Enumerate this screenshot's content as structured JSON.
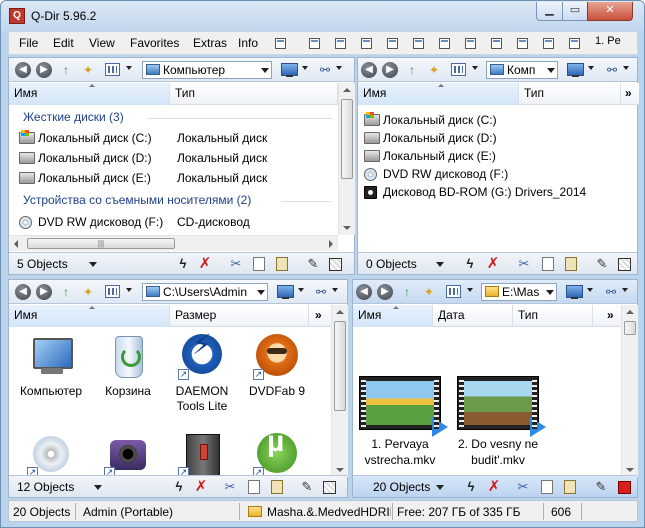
{
  "window": {
    "title": "Q-Dir 5.96.2",
    "app_icon": "Q"
  },
  "menu": {
    "items": [
      "File",
      "Edit",
      "View",
      "Favorites",
      "Extras",
      "Info"
    ],
    "right": "1. Pe"
  },
  "panes": {
    "top_left": {
      "address": "Компьютер",
      "columns": [
        "Имя",
        "Тип"
      ],
      "groups": [
        {
          "title": "Жесткие диски (3)",
          "rows": [
            {
              "name": "Локальный диск (C:)",
              "type": "Локальный диск"
            },
            {
              "name": "Локальный диск (D:)",
              "type": "Локальный диск"
            },
            {
              "name": "Локальный диск (E:)",
              "type": "Локальный диск"
            }
          ]
        },
        {
          "title": "Устройства со съемными носителями (2)",
          "rows": [
            {
              "name": "DVD RW дисковод (F:)",
              "type": "CD-дисковод"
            }
          ]
        }
      ],
      "status": "5 Objects"
    },
    "top_right": {
      "address": "Комп",
      "columns": [
        "Имя",
        "Тип"
      ],
      "more": "»",
      "rows": [
        "Локальный диск (C:)",
        "Локальный диск (D:)",
        "Локальный диск (E:)",
        "DVD RW дисковод (F:)",
        "Дисковод BD-ROM (G:) Drivers_2014"
      ],
      "status": "0 Objects"
    },
    "bottom_left": {
      "address": "C:\\Users\\Admin",
      "columns": [
        "Имя",
        "Размер"
      ],
      "more": "»",
      "icons": [
        {
          "label1": "Компьютер",
          "label2": ""
        },
        {
          "label1": "Корзина",
          "label2": ""
        },
        {
          "label1": "DAEMON",
          "label2": "Tools Lite"
        },
        {
          "label1": "DVDFab 9",
          "label2": ""
        }
      ],
      "status": "12 Objects"
    },
    "bottom_right": {
      "address": "E:\\Mas",
      "columns": [
        "Имя",
        "Дата",
        "Тип"
      ],
      "more": "»",
      "videos": [
        {
          "line1": "1. Pervaya",
          "line2": "vstrecha.mkv"
        },
        {
          "line1": "2. Do vesny ne",
          "line2": "budit'.mkv"
        }
      ],
      "status": "20 Objects"
    }
  },
  "global_status": {
    "count": "20 Objects",
    "user": "Admin (Portable)",
    "folder": "Masha.&.MedvedHDRIP",
    "free": "Free: 207 ГБ of 335 ГБ",
    "num": "606"
  },
  "colors": {
    "accent": "#1e3f8a",
    "frame": "#bcd3ec",
    "close": "#c8503a"
  }
}
